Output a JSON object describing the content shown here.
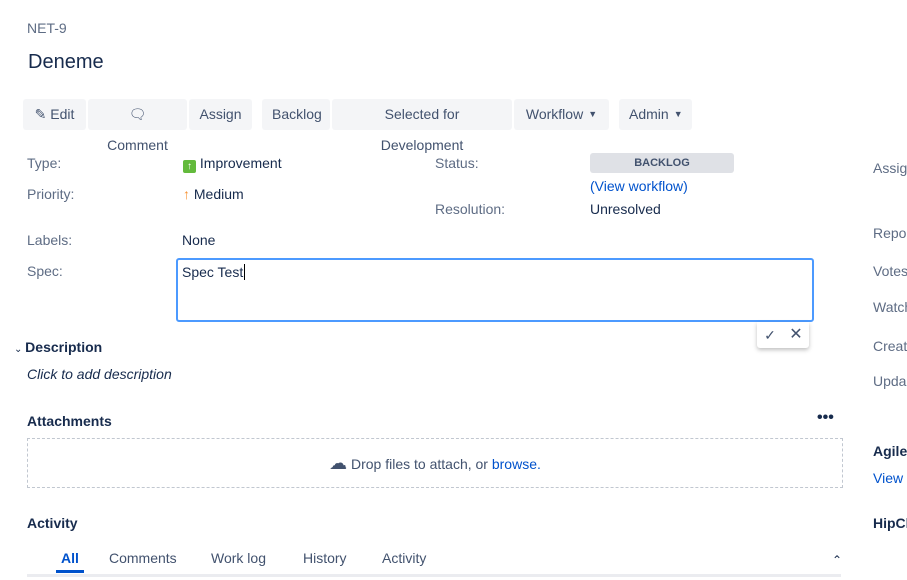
{
  "issue": {
    "key": "NET-9",
    "title": "Deneme"
  },
  "toolbar": {
    "edit": "Edit",
    "comment": "Comment",
    "assign": "Assign",
    "backlog": "Backlog",
    "selected": "Selected for Development",
    "workflow": "Workflow",
    "admin": "Admin"
  },
  "details": {
    "type_label": "Type:",
    "type_value": "Improvement",
    "priority_label": "Priority:",
    "priority_value": "Medium",
    "labels_label": "Labels:",
    "labels_value": "None",
    "spec_label": "Spec:",
    "spec_value": "Spec Test",
    "status_label": "Status:",
    "status_value": "BACKLOG",
    "view_workflow": "(View workflow)",
    "resolution_label": "Resolution:",
    "resolution_value": "Unresolved"
  },
  "description": {
    "title": "Description",
    "placeholder": "Click to add description"
  },
  "attachments": {
    "title": "Attachments",
    "drop_text": "Drop files to attach, or ",
    "browse": "browse."
  },
  "activity": {
    "title": "Activity",
    "tabs": [
      "All",
      "Comments",
      "Work log",
      "History",
      "Activity"
    ]
  },
  "right": {
    "assignee": "Assig",
    "reporter": "Repo",
    "votes": "Votes",
    "watchers": "Watch",
    "created": "Creat",
    "updated": "Upda",
    "agile": "Agile",
    "view": "View",
    "hipchat": "HipCl"
  }
}
